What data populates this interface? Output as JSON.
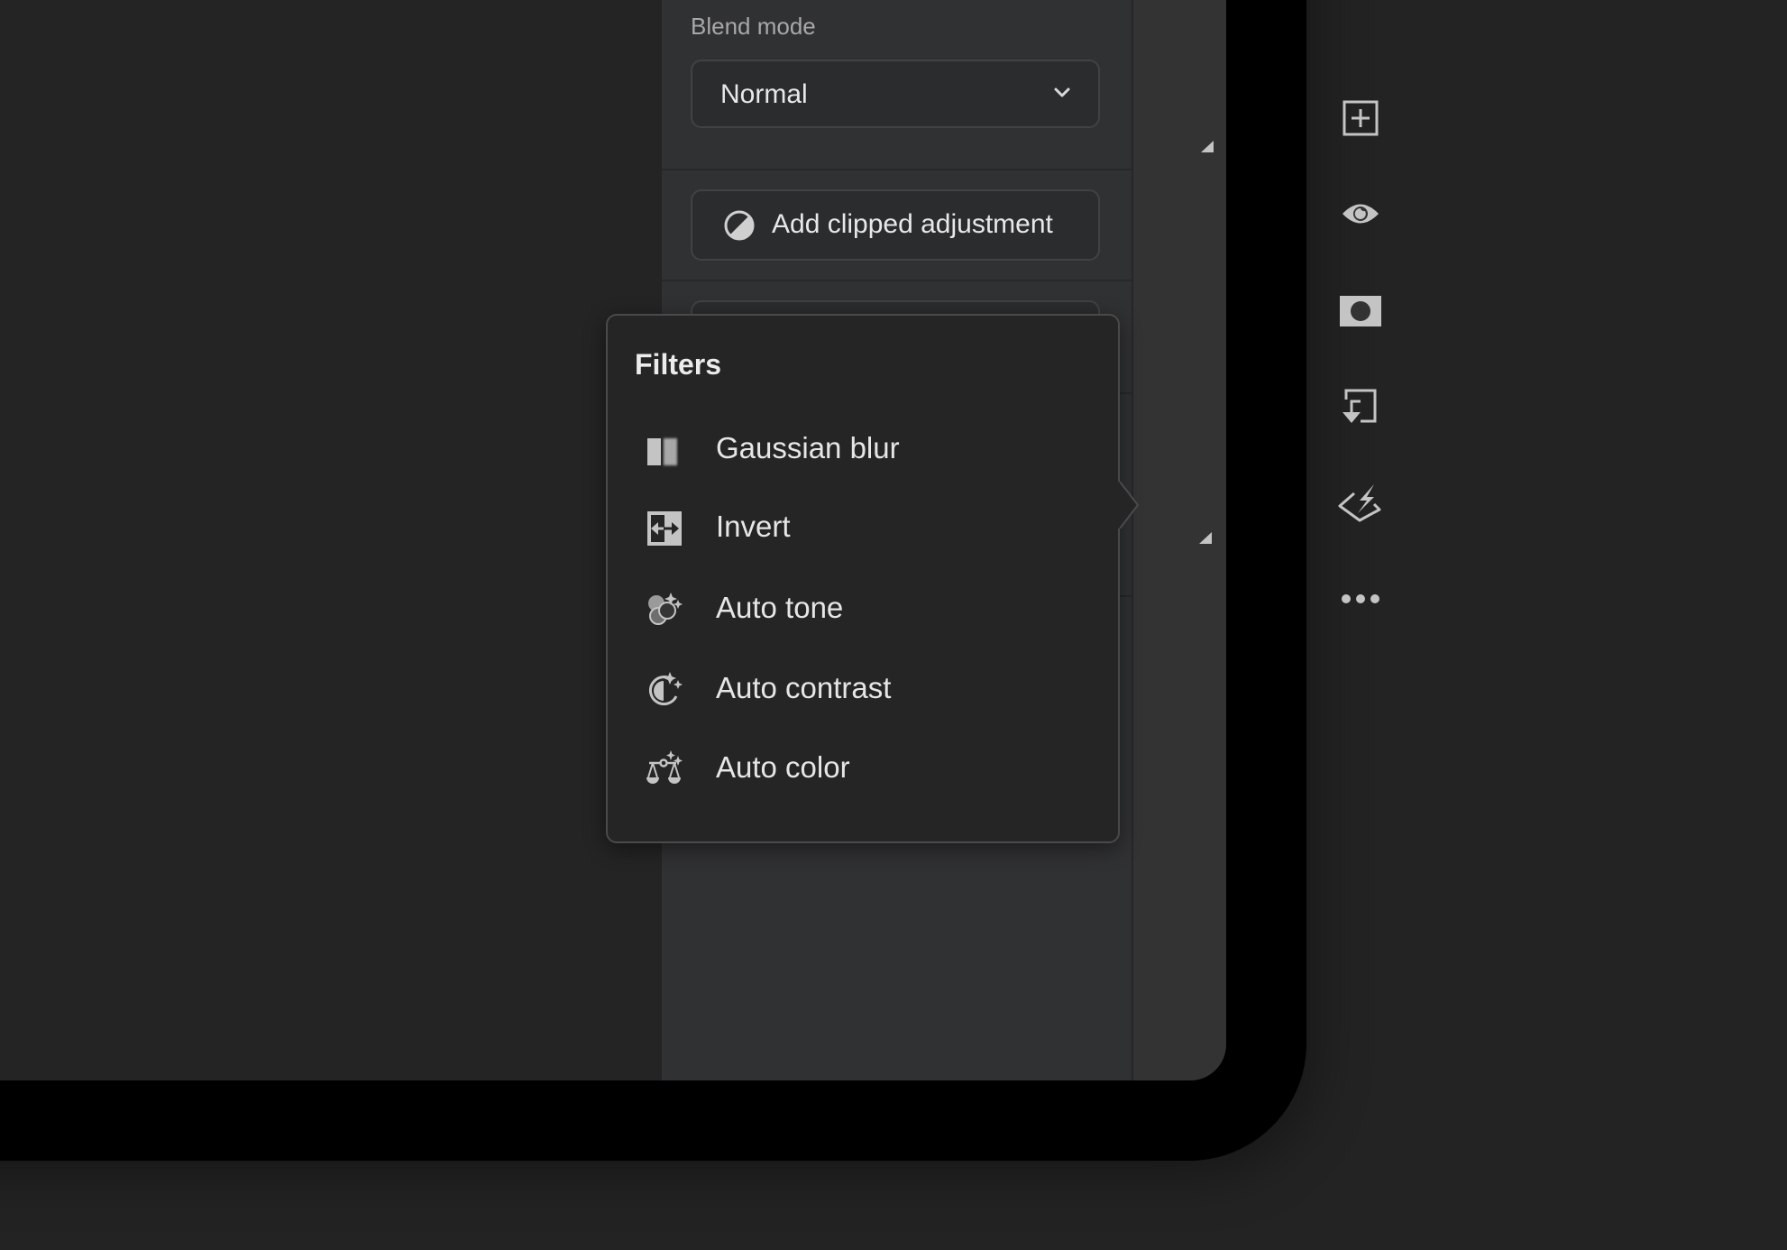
{
  "panel": {
    "blend_mode_label": "Blend mode",
    "blend_mode_value": "Normal",
    "add_clipped_adjustment_label": "Add clipped adjustment"
  },
  "rail": {
    "items": [
      {
        "icon": "add-layer-icon",
        "has_submenu": true
      },
      {
        "icon": "eye-icon",
        "has_submenu": false
      },
      {
        "icon": "mask-icon",
        "has_submenu": false
      },
      {
        "icon": "merge-down-icon",
        "has_submenu": false
      },
      {
        "icon": "filters-icon",
        "has_submenu": true,
        "active": true
      },
      {
        "icon": "more-icon",
        "has_submenu": false
      }
    ]
  },
  "filters_popover": {
    "title": "Filters",
    "items": [
      {
        "label": "Gaussian blur",
        "icon": "gaussian-blur-icon"
      },
      {
        "label": "Invert",
        "icon": "invert-icon"
      },
      {
        "label": "Auto tone",
        "icon": "auto-tone-icon"
      },
      {
        "label": "Auto contrast",
        "icon": "auto-contrast-icon"
      },
      {
        "label": "Auto color",
        "icon": "auto-color-icon"
      }
    ]
  },
  "colors": {
    "icon": "#c4c4c4",
    "text": "#e8e8e8",
    "panel_bg": "#303133",
    "rail_bg": "#333333",
    "popover_bg": "#252525"
  }
}
